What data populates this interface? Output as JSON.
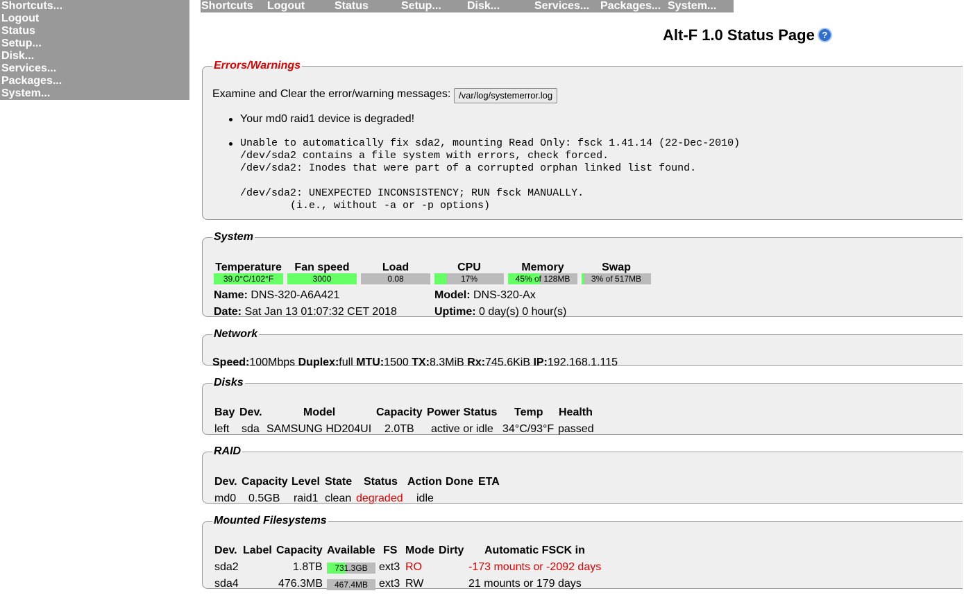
{
  "side_menu": [
    "Shortcuts...",
    "Logout",
    "Status",
    "Setup...",
    "Disk...",
    "Services...",
    "Packages...",
    "System..."
  ],
  "top_menu": [
    "Shortcuts",
    "Logout",
    "Status",
    "Setup...",
    "Disk...",
    "Services...",
    "Packages...",
    "System..."
  ],
  "page_title": "Alt-F 1.0 Status Page",
  "help_icon": "?",
  "errors": {
    "legend": "Errors/Warnings",
    "examine_text": "Examine and Clear the error/warning messages:",
    "log_button": "/var/log/systemerror.log",
    "msg1": "Your md0 raid1 device is degraded!",
    "msg2": "Unable to automatically fix sda2, mounting Read Only: fsck 1.41.14 (22-Dec-2010)\n/dev/sda2 contains a file system with errors, check forced.\n/dev/sda2: Inodes that were part of a corrupted orphan linked list found.\n\n/dev/sda2: UNEXPECTED INCONSISTENCY; RUN fsck MANUALLY.\n        (i.e., without -a or -p options)"
  },
  "system": {
    "legend": "System",
    "gauges": [
      {
        "label": "Temperature",
        "text": "39.0°C/102°F",
        "fill": 1.0
      },
      {
        "label": "Fan speed",
        "text": "3000",
        "fill": 1.0
      },
      {
        "label": "Load",
        "text": "0.08",
        "fill": 0.0
      },
      {
        "label": "CPU",
        "text": "17%",
        "fill": 0.17
      },
      {
        "label": "Memory",
        "text": "45% of 128MB",
        "fill": 0.45
      },
      {
        "label": "Swap",
        "text": "3% of 517MB",
        "fill": 0.03
      }
    ],
    "name_label": "Name:",
    "name_value": " DNS-320-A6A421",
    "model_label": "Model:",
    "model_value": " DNS-320-Ax",
    "date_label": "Date:",
    "date_value": " Sat Jan 13 01:07:32 CET 2018",
    "uptime_label": "Uptime:",
    "uptime_value": " 0 day(s) 0 hour(s)"
  },
  "network": {
    "legend": "Network",
    "speed_label": "Speed:",
    "speed": "100Mbps",
    "duplex_label": "Duplex:",
    "duplex": "full",
    "mtu_label": "MTU:",
    "mtu": "1500",
    "tx_label": "TX:",
    "tx": "8.3MiB",
    "rx_label": "Rx:",
    "rx": "745.6KiB",
    "ip_label": "IP:",
    "ip": "192.168.1.115"
  },
  "disks": {
    "legend": "Disks",
    "headers": [
      "Bay",
      "Dev.",
      "Model",
      "Capacity",
      "Power Status",
      "Temp",
      "Health"
    ],
    "row": [
      "left",
      "sda",
      "SAMSUNG HD204UI",
      "2.0TB",
      "active or idle",
      "34°C/93°F",
      "passed"
    ]
  },
  "raid": {
    "legend": "RAID",
    "headers": [
      "Dev.",
      "Capacity",
      "Level",
      "State",
      "Status",
      "Action",
      "Done",
      "ETA"
    ],
    "row": [
      "md0",
      "0.5GB",
      "raid1",
      "clean",
      "degraded",
      "idle"
    ]
  },
  "filesystems": {
    "legend": "Mounted Filesystems",
    "headers": [
      "Dev.",
      "Label",
      "Capacity",
      "Available",
      "FS",
      "Mode",
      "Dirty",
      "Automatic FSCK in"
    ],
    "rows": [
      {
        "dev": "sda2",
        "capacity": "1.8TB",
        "available": "731.3GB",
        "avail_fill": 0.39,
        "fs": "ext3",
        "mode": "RO",
        "fsck": "-173 mounts or -2092 days"
      },
      {
        "dev": "sda4",
        "capacity": "476.3MB",
        "available": "467.4MB",
        "avail_fill": 0.0,
        "fs": "ext3",
        "mode": "RW",
        "fsck": "21 mounts or 179 days"
      }
    ]
  },
  "colors": {
    "menu_bg": "#999999",
    "panel_bg": "#efefef",
    "bar_fill": "#66ff66",
    "bar_bg": "#bbbbbb",
    "alert": "#e00000"
  }
}
